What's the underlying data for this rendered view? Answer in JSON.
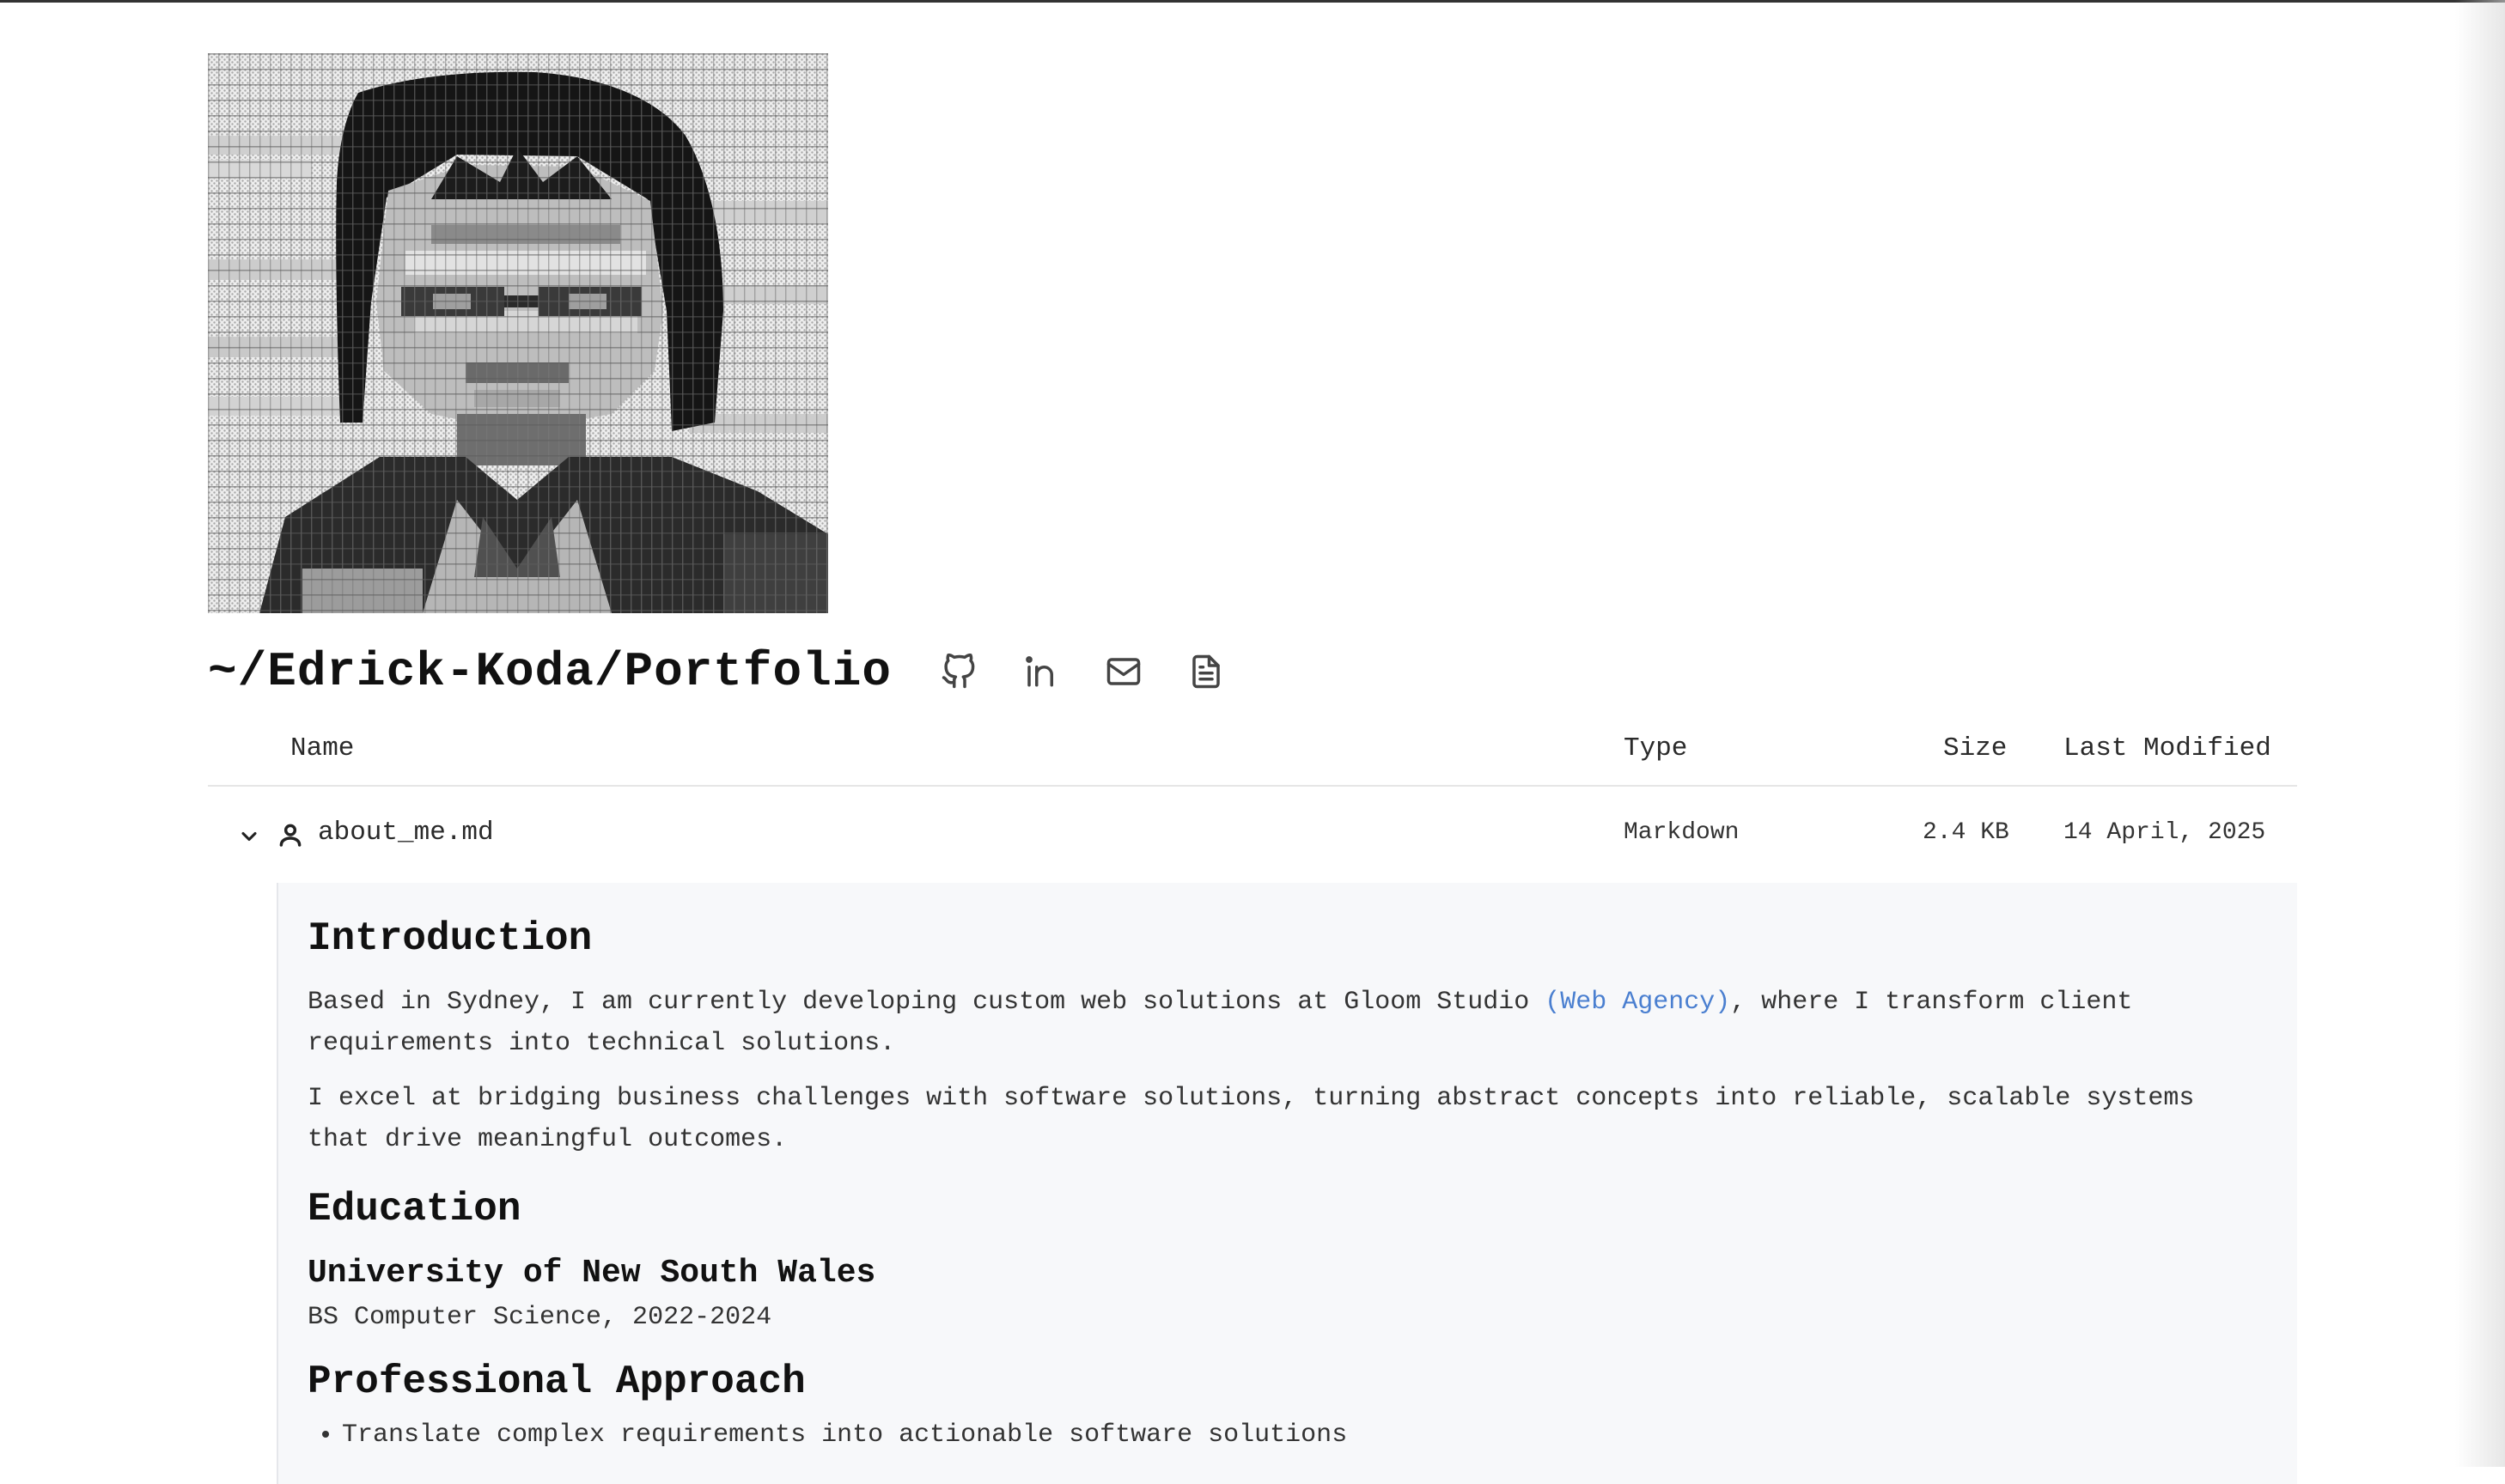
{
  "title": "~/Edrick-Koda/Portfolio",
  "social_icons": [
    "github-icon",
    "linkedin-icon",
    "mail-icon",
    "resume-document-icon"
  ],
  "table": {
    "headers": {
      "name": "Name",
      "type": "Type",
      "size": "Size",
      "modified": "Last Modified"
    }
  },
  "file": {
    "name": "about_me.md",
    "type": "Markdown",
    "size": "2.4 KB",
    "modified": "14 April, 2025",
    "icon": "person-icon",
    "expanded_icon": "chevron-down-icon"
  },
  "content": {
    "intro_heading": "Introduction",
    "intro_p1_before": "Based in Sydney, I am currently developing custom web solutions at Gloom Studio ",
    "intro_p1_link": "(Web Agency)",
    "intro_p1_after": ", where I transform client requirements into technical solutions.",
    "intro_p2": "I excel at bridging business challenges with software solutions, turning abstract concepts into reliable, scalable systems that drive meaningful outcomes.",
    "education_heading": "Education",
    "university": "University of New South Wales",
    "degree": "BS Computer Science, 2022-2024",
    "approach_heading": "Professional Approach",
    "approach_items": [
      "Translate complex requirements into actionable software solutions"
    ]
  },
  "colors": {
    "link": "#4a7fd0",
    "panel_bg": "#f7f8fa",
    "text": "#333333"
  }
}
